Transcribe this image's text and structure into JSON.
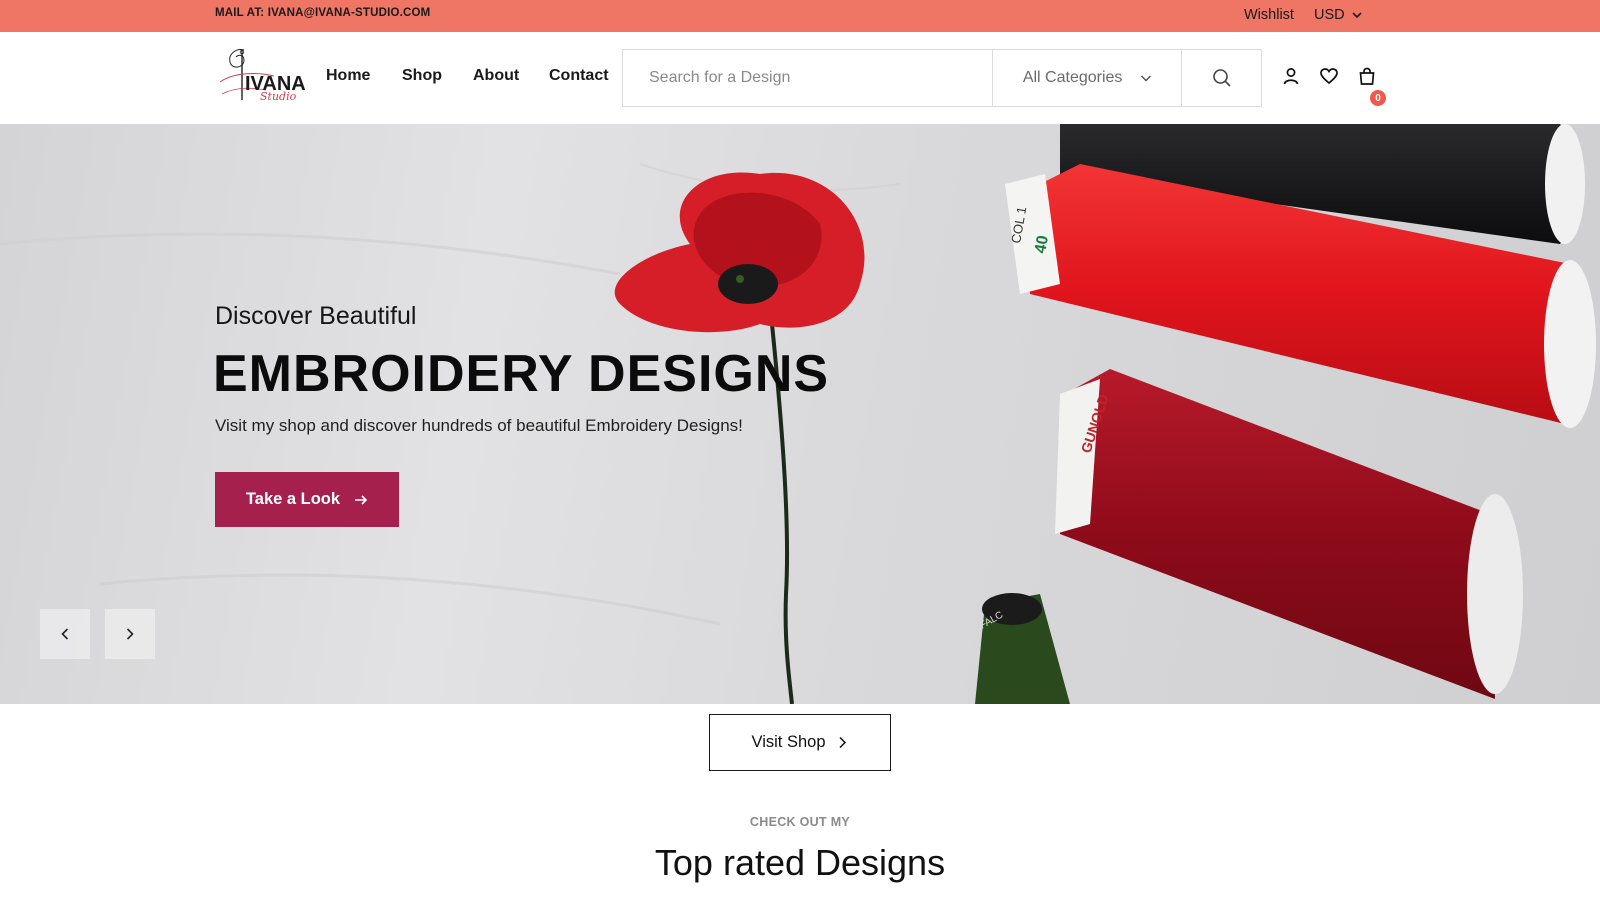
{
  "topbar": {
    "mail": "MAIL AT: IVANA@IVANA-STUDIO.COM",
    "wishlist": "Wishlist",
    "currency": "USD"
  },
  "header": {
    "logo_text": "IVANA",
    "logo_script": "Studio",
    "nav": [
      "Home",
      "Shop",
      "About",
      "Contact"
    ],
    "search_placeholder": "Search for a Design",
    "category_label": "All Categories",
    "cart_count": "0"
  },
  "hero": {
    "subtitle": "Discover Beautiful",
    "title": "EMBROIDERY DESIGNS",
    "text": "Visit my shop and discover hundreds of beautiful Embroidery Designs!",
    "button_label": "Take a Look",
    "spool_labels": [
      "COL 1",
      "40",
      "GUNOLD",
      "FALC"
    ]
  },
  "visit_shop_label": "Visit Shop",
  "section": {
    "kicker": "CHECK OUT MY",
    "title": "Top rated Designs"
  },
  "colors": {
    "topbar": "#ef7565",
    "accent": "#a6204e",
    "badge": "#ef5a4c"
  }
}
